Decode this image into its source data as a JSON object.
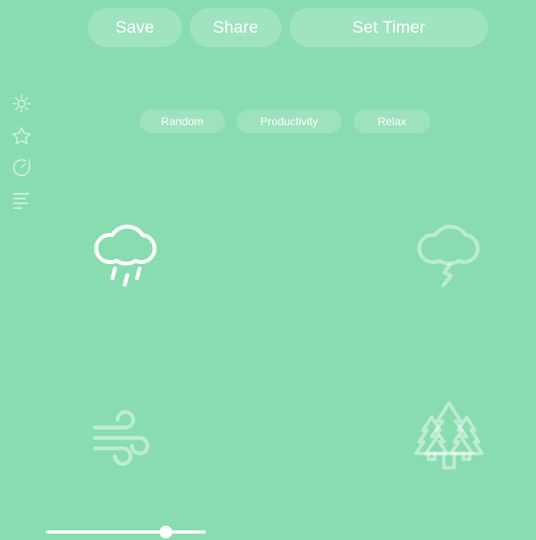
{
  "app": {
    "background_color": "#88dcaf",
    "accent_color": "#ffffff"
  },
  "toolbar": {
    "buttons": [
      {
        "label": "Save",
        "name": "save-button",
        "active": false
      },
      {
        "label": "Share",
        "name": "share-button",
        "active": false
      },
      {
        "label": "Set Timer",
        "name": "set-timer-button",
        "active": false
      }
    ]
  },
  "tags": {
    "items": [
      {
        "label": "Random",
        "name": "tag-random"
      },
      {
        "label": "Productivity",
        "name": "tag-productivity"
      },
      {
        "label": "Relax",
        "name": "tag-relax"
      }
    ]
  },
  "sidebar": {
    "items": [
      {
        "icon": "gear-icon",
        "label": "Settings"
      },
      {
        "icon": "star-icon",
        "label": "Favorites"
      },
      {
        "icon": "timer-icon",
        "label": "Timer"
      },
      {
        "icon": "list-icon",
        "label": "Playlist"
      }
    ]
  },
  "sounds": {
    "items": [
      {
        "name": "rain",
        "icon": "rain-cloud-icon",
        "label": "Rain",
        "active": true,
        "volume": 75
      },
      {
        "name": "thunder",
        "icon": "thunder-cloud-icon",
        "label": "Thunder",
        "active": false,
        "volume": 0
      },
      {
        "name": "wind",
        "icon": "wind-icon",
        "label": "Wind",
        "active": false,
        "volume": 0
      },
      {
        "name": "forest",
        "icon": "forest-trees-icon",
        "label": "Forest",
        "active": false,
        "volume": 0
      }
    ]
  },
  "volume_slider": {
    "for_sound": "rain",
    "value": 75,
    "min": 0,
    "max": 100
  }
}
